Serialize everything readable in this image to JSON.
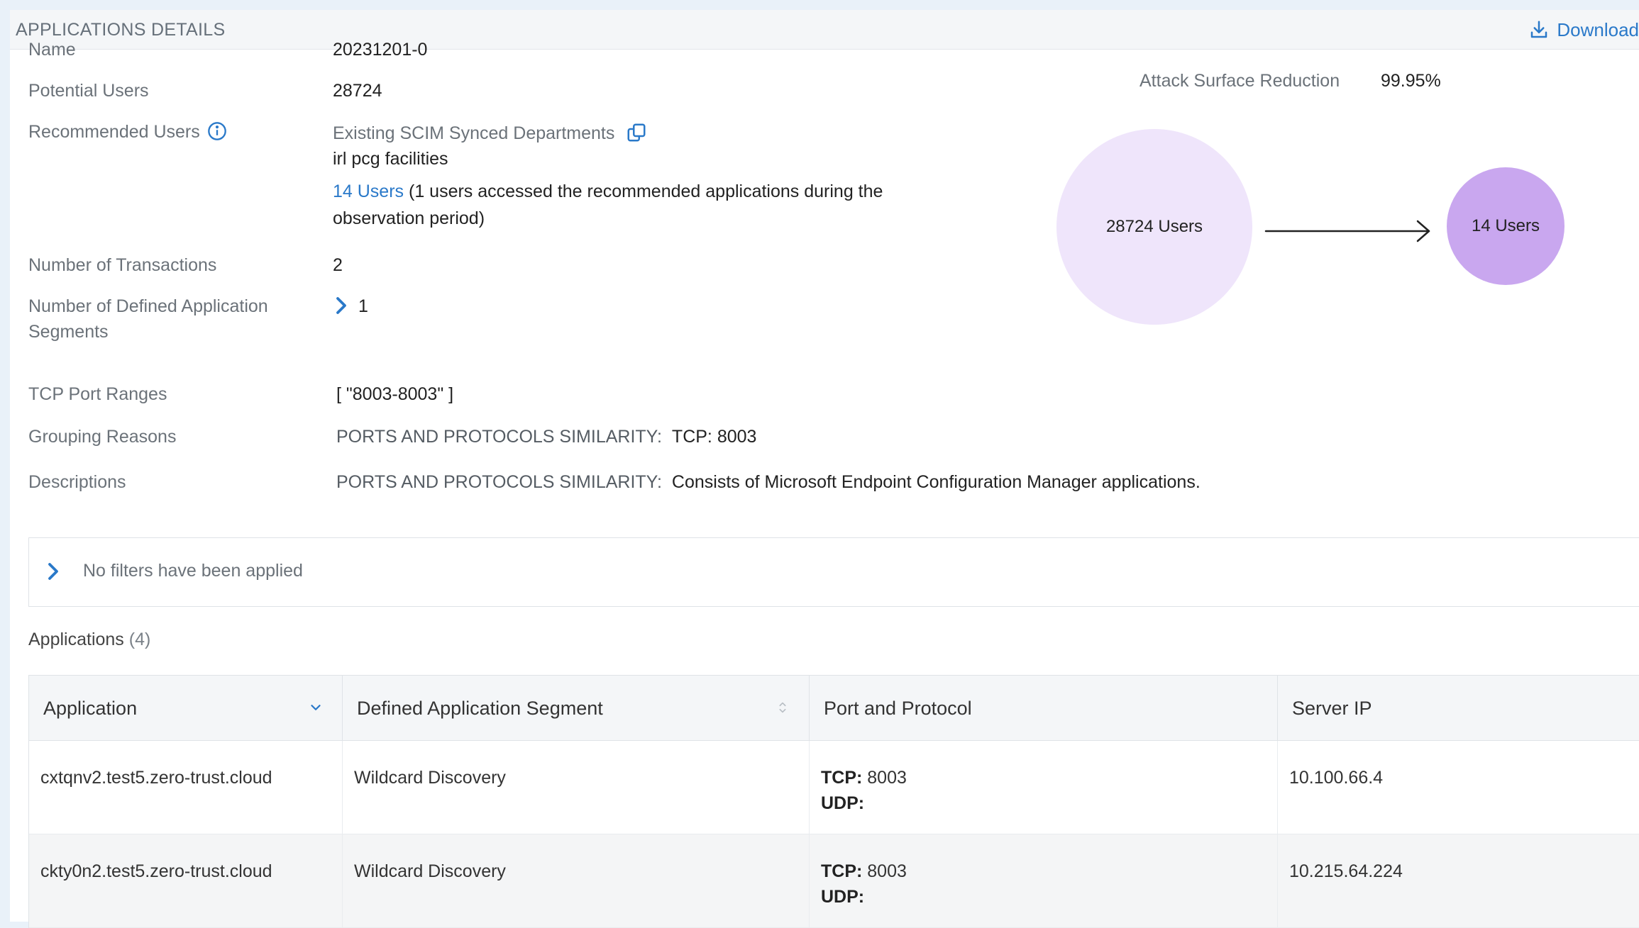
{
  "header": {
    "title": "APPLICATIONS DETAILS",
    "download_label": "Download"
  },
  "details": {
    "name_label": "Name",
    "name_value": "20231201-0",
    "potential_users_label": "Potential Users",
    "potential_users_value": "28724",
    "recommended_users_label": "Recommended Users",
    "recommended_source": "Existing SCIM Synced Departments",
    "recommended_department": "irl pcg facilities",
    "recommended_users_link": "14 Users",
    "recommended_users_note_1": "(1 users accessed the recommended applications during the",
    "recommended_users_note_2": "observation period)",
    "transactions_label": "Number of Transactions",
    "transactions_value": "2",
    "segments_label_1": "Number of Defined Application",
    "segments_label_2": "Segments",
    "segments_value": "1",
    "tcp_label": "TCP Port Ranges",
    "tcp_value": "[ \"8003-8003\" ]",
    "grouping_label": "Grouping Reasons",
    "grouping_key": "PORTS AND PROTOCOLS SIMILARITY:",
    "grouping_value": "TCP: 8003",
    "descriptions_label": "Descriptions",
    "descriptions_key": "PORTS AND PROTOCOLS SIMILARITY:",
    "descriptions_value": "Consists of Microsoft Endpoint Configuration Manager applications."
  },
  "attack_surface": {
    "label": "Attack Surface Reduction",
    "value": "99.95%",
    "from_users": "28724 Users",
    "to_users": "14 Users"
  },
  "filters": {
    "text": "No filters have been applied"
  },
  "applications": {
    "heading": "Applications",
    "count": "(4)",
    "columns": [
      "Application",
      "Defined Application Segment",
      "Port and Protocol",
      "Server IP"
    ],
    "rows": [
      {
        "application": "cxtqnv2.test5.zero-trust.cloud",
        "segment": "Wildcard Discovery",
        "tcp_label": "TCP:",
        "tcp_value": "8003",
        "udp_label": "UDP:",
        "udp_value": "",
        "server_ip": "10.100.66.4"
      },
      {
        "application": "ckty0n2.test5.zero-trust.cloud",
        "segment": "Wildcard Discovery",
        "tcp_label": "TCP:",
        "tcp_value": "8003",
        "udp_label": "UDP:",
        "udp_value": "",
        "server_ip": "10.215.64.224"
      }
    ]
  },
  "colors": {
    "accent": "#2a79c9",
    "big_circle": "#efe5fb",
    "small_circle": "#c9a7ef"
  },
  "icons": {
    "download": "download-icon",
    "info": "info-icon",
    "copy": "copy-icon",
    "chevron_right": "chevron-right-icon",
    "chevron_down": "chevron-down-icon",
    "sort": "sort-icon",
    "arrow": "arrow-right-icon"
  }
}
